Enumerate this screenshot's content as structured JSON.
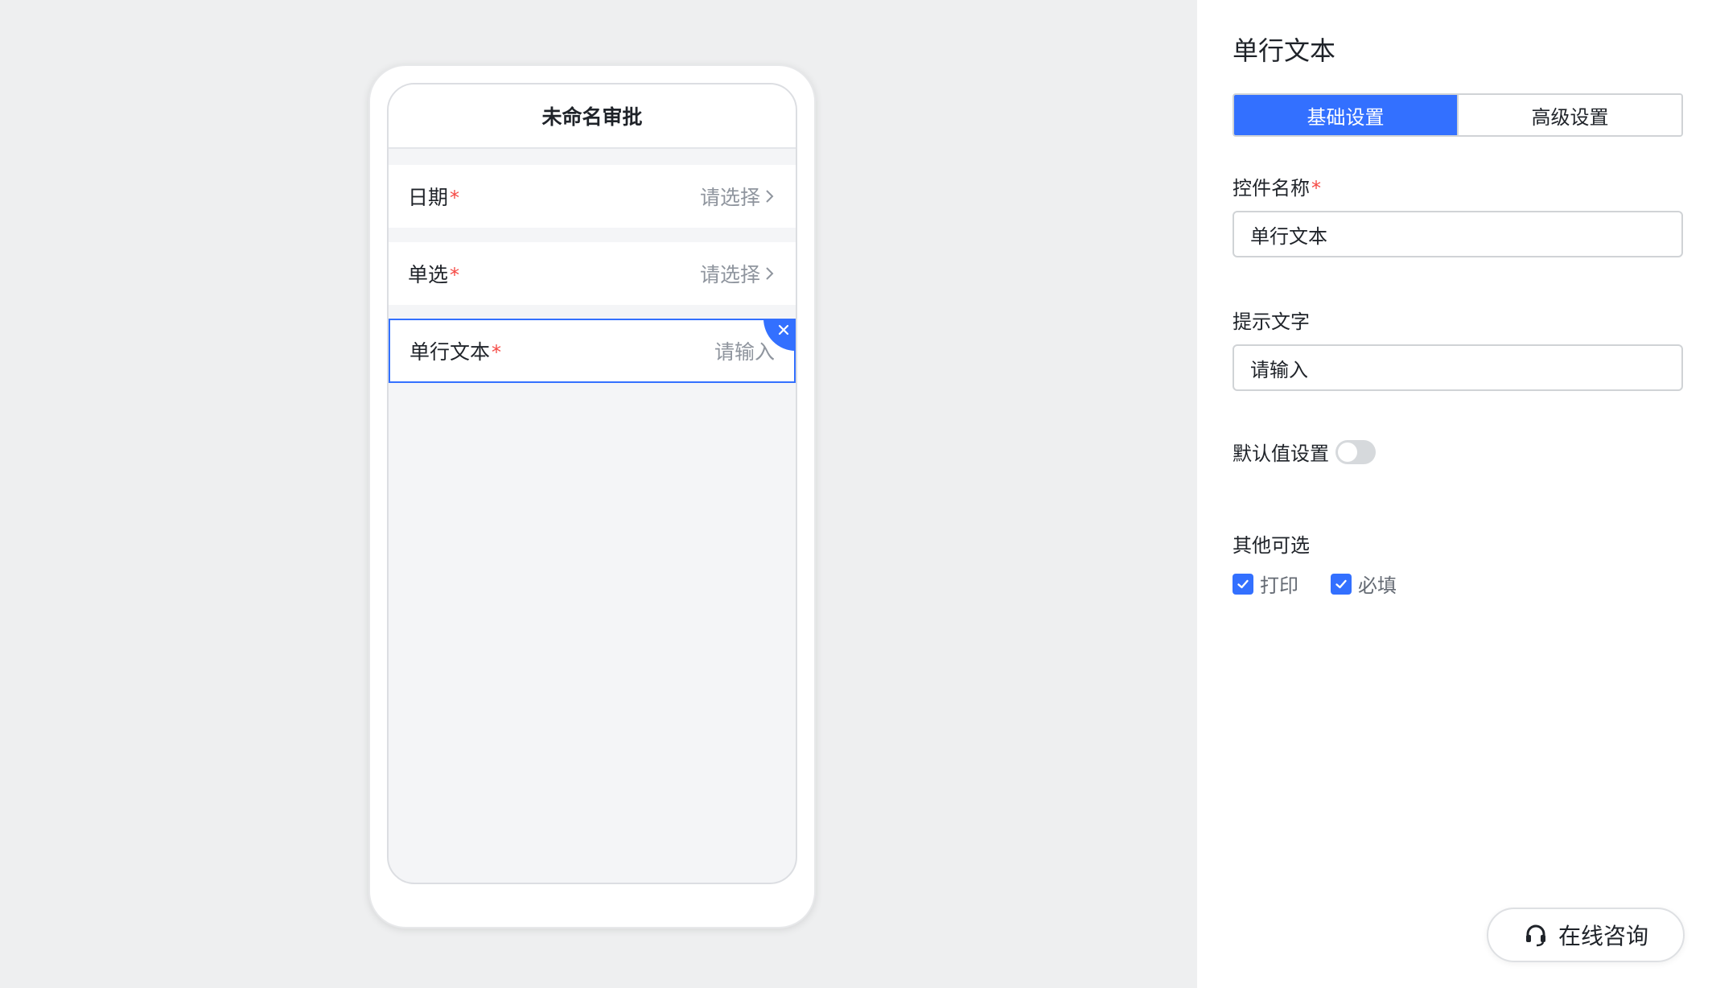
{
  "phone": {
    "title": "未命名审批",
    "fields": [
      {
        "label": "日期",
        "required": "*",
        "placeholder": "请选择"
      },
      {
        "label": "单选",
        "required": "*",
        "placeholder": "请选择"
      },
      {
        "label": "单行文本",
        "required": "*",
        "placeholder": "请输入"
      }
    ]
  },
  "panel": {
    "title": "单行文本",
    "tabs": [
      {
        "label": "基础设置",
        "active": true
      },
      {
        "label": "高级设置",
        "active": false
      }
    ],
    "control_name": {
      "label": "控件名称",
      "required": "*",
      "value": "单行文本"
    },
    "hint_text": {
      "label": "提示文字",
      "value": "请输入"
    },
    "default_value": {
      "label": "默认值设置",
      "enabled": false
    },
    "other_options": {
      "label": "其他可选",
      "options": [
        {
          "label": "打印",
          "checked": true
        },
        {
          "label": "必填",
          "checked": true
        }
      ]
    }
  },
  "consult_button": {
    "label": "在线咨询"
  },
  "colors": {
    "accent": "#3370ff",
    "required": "#f54a45",
    "canvas_bg": "#eeeff0"
  }
}
